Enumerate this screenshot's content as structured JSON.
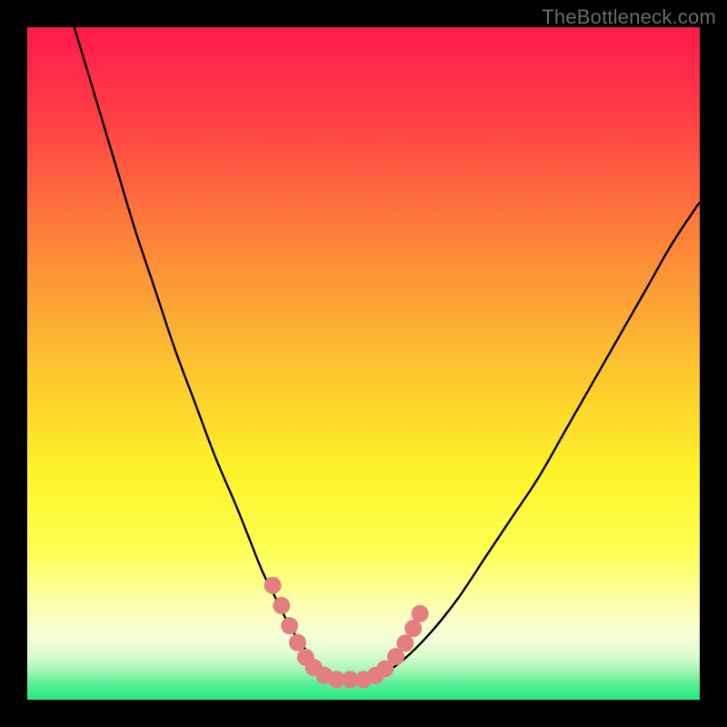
{
  "watermark": "TheBottleneck.com",
  "colors": {
    "frame": "#000000",
    "curve": "#000000",
    "marker": "#e37f80",
    "green_band": "#27e884"
  },
  "chart_data": {
    "type": "line",
    "title": "",
    "xlabel": "",
    "ylabel": "",
    "xlim": [
      0,
      100
    ],
    "ylim": [
      0,
      100
    ],
    "gradient_stops": [
      {
        "offset": 0.0,
        "color": "#ff1a4b"
      },
      {
        "offset": 0.12,
        "color": "#ff3a48"
      },
      {
        "offset": 0.3,
        "color": "#fd7d3a"
      },
      {
        "offset": 0.5,
        "color": "#fcc22f"
      },
      {
        "offset": 0.66,
        "color": "#fef328"
      },
      {
        "offset": 0.78,
        "color": "#feff55"
      },
      {
        "offset": 0.86,
        "color": "#fcffb0"
      },
      {
        "offset": 0.905,
        "color": "#f4fdd8"
      },
      {
        "offset": 0.935,
        "color": "#d9fccd"
      },
      {
        "offset": 0.955,
        "color": "#a8f7b4"
      },
      {
        "offset": 0.975,
        "color": "#5bef96"
      },
      {
        "offset": 1.0,
        "color": "#27e884"
      }
    ],
    "series": [
      {
        "name": "bottleneck-curve",
        "x": [
          7,
          10,
          13,
          16,
          19,
          22,
          25,
          28,
          31,
          33,
          35,
          37,
          39,
          41,
          43,
          45,
          47,
          50,
          53,
          56,
          60,
          64,
          68,
          72,
          76,
          80,
          84,
          88,
          92,
          96,
          100
        ],
        "y": [
          100,
          90,
          80,
          70,
          61,
          52,
          44,
          36,
          29,
          24,
          19,
          15,
          11,
          8,
          5.5,
          4,
          3,
          3,
          4,
          6,
          10,
          15,
          21,
          27,
          33,
          40,
          47,
          54,
          61,
          68,
          74
        ]
      }
    ],
    "markers": {
      "name": "highlight-band",
      "points": [
        {
          "x": 36.5,
          "y": 17
        },
        {
          "x": 37.8,
          "y": 14
        },
        {
          "x": 39.0,
          "y": 11
        },
        {
          "x": 40.2,
          "y": 8.5
        },
        {
          "x": 41.4,
          "y": 6.3
        },
        {
          "x": 42.6,
          "y": 4.8
        },
        {
          "x": 44.2,
          "y": 3.6
        },
        {
          "x": 46.0,
          "y": 3.0
        },
        {
          "x": 48.0,
          "y": 3.0
        },
        {
          "x": 50.0,
          "y": 3.0
        },
        {
          "x": 51.8,
          "y": 3.6
        },
        {
          "x": 53.2,
          "y": 4.6
        },
        {
          "x": 54.8,
          "y": 6.4
        },
        {
          "x": 56.2,
          "y": 8.4
        },
        {
          "x": 57.4,
          "y": 10.6
        },
        {
          "x": 58.4,
          "y": 12.8
        }
      ]
    }
  }
}
